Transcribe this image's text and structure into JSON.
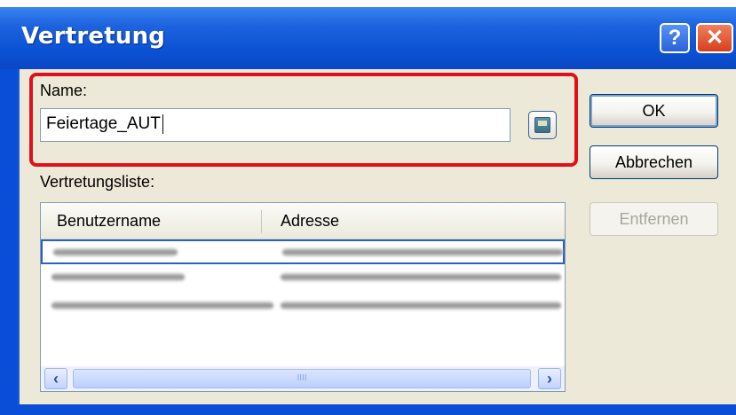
{
  "window": {
    "title": "Vertretung",
    "help_label": "?",
    "close_label": "✕"
  },
  "form": {
    "name_label": "Name:",
    "name_value": "Feiertage_AUT",
    "list_label": "Vertretungsliste:"
  },
  "buttons": {
    "ok": "OK",
    "cancel": "Abbrechen",
    "remove": "Entfernen"
  },
  "list": {
    "columns": [
      "Benutzername",
      "Adresse"
    ],
    "rows_visible": 3,
    "scroll_thumb_glyph": "IIII"
  },
  "icons": {
    "address_book": "address-book-icon",
    "scroll_left": "chevron-left-icon",
    "scroll_right": "chevron-right-icon"
  },
  "colors": {
    "titlebar": "#0a52d4",
    "highlight": "#e0101b",
    "client": "#ece9d8"
  }
}
